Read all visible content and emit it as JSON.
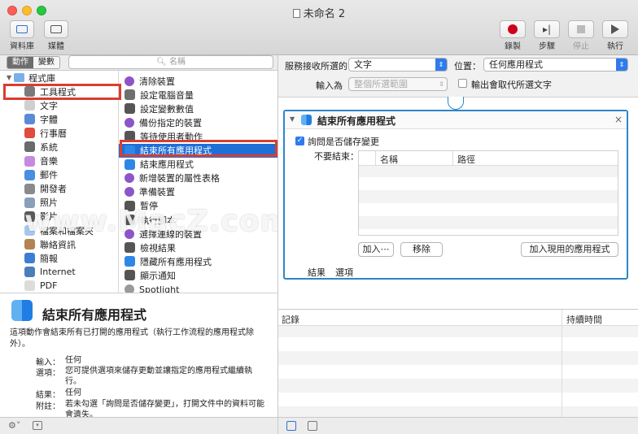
{
  "window": {
    "title": "未命名 2"
  },
  "toolbar": {
    "library_label": "資料庫",
    "media_label": "媒體",
    "record_label": "錄製",
    "step_label": "步驟",
    "stop_label": "停止",
    "run_label": "執行"
  },
  "left": {
    "actions_tab": "動作",
    "variables_tab": "變數",
    "search_placeholder": "名稱",
    "library_root": "程式庫",
    "categories": [
      {
        "label": "工具程式",
        "icon": "tools-icon",
        "color": "#7a7a7a"
      },
      {
        "label": "文字",
        "icon": "text-icon",
        "color": "#cfcfcf"
      },
      {
        "label": "字體",
        "icon": "font-icon",
        "color": "#5a8bd6"
      },
      {
        "label": "行事曆",
        "icon": "calendar-icon",
        "color": "#e04b3c"
      },
      {
        "label": "系統",
        "icon": "system-icon",
        "color": "#6a6a6a"
      },
      {
        "label": "音樂",
        "icon": "music-icon",
        "color": "#c58be0"
      },
      {
        "label": "郵件",
        "icon": "mail-icon",
        "color": "#4a8ee0"
      },
      {
        "label": "開發者",
        "icon": "developer-icon",
        "color": "#8a8a8a"
      },
      {
        "label": "照片",
        "icon": "photos-icon",
        "color": "#8aa0b8"
      },
      {
        "label": "影片",
        "icon": "movies-icon",
        "color": "#5b5b5b"
      },
      {
        "label": "檔案和檔案夾",
        "icon": "folder-icon",
        "color": "#a6c8ec"
      },
      {
        "label": "聯絡資訊",
        "icon": "contacts-icon",
        "color": "#b38451"
      },
      {
        "label": "簡報",
        "icon": "presentation-icon",
        "color": "#3d7dd4"
      },
      {
        "label": "Internet",
        "icon": "internet-icon",
        "color": "#4a7fb8"
      },
      {
        "label": "PDF",
        "icon": "pdf-icon",
        "color": "#dcdcdc"
      }
    ],
    "actions": [
      {
        "label": "清除裝置",
        "icon": "device-icon",
        "color": "#8d55c7"
      },
      {
        "label": "設定電腦音量",
        "icon": "volume-icon",
        "color": "#6e6e6e"
      },
      {
        "label": "設定變數數值",
        "icon": "robot-icon",
        "color": "#555555"
      },
      {
        "label": "備份指定的裝置",
        "icon": "device-icon",
        "color": "#8d55c7"
      },
      {
        "label": "等待使用者動作",
        "icon": "robot-icon",
        "color": "#555555"
      },
      {
        "label": "結束所有應用程式",
        "icon": "finder-icon",
        "color": "#2e86e6"
      },
      {
        "label": "結束應用程式",
        "icon": "finder-icon",
        "color": "#2e86e6"
      },
      {
        "label": "新增裝置的屬性表格",
        "icon": "device-icon",
        "color": "#8d55c7"
      },
      {
        "label": "準備裝置",
        "icon": "device-icon",
        "color": "#8d55c7"
      },
      {
        "label": "暫停",
        "icon": "robot-icon",
        "color": "#555555"
      },
      {
        "label": "執行腳本",
        "icon": "robot-icon",
        "color": "#555555"
      },
      {
        "label": "選擇連線的裝置",
        "icon": "device-icon",
        "color": "#8d55c7"
      },
      {
        "label": "檢視結果",
        "icon": "robot-icon",
        "color": "#555555"
      },
      {
        "label": "隱藏所有應用程式",
        "icon": "finder-icon",
        "color": "#2e86e6"
      },
      {
        "label": "顯示通知",
        "icon": "robot-icon",
        "color": "#555555"
      },
      {
        "label": "Spotlight",
        "icon": "spotlight-icon",
        "color": "#9a9a9a"
      }
    ],
    "selected_category": 0,
    "selected_action": 5
  },
  "description": {
    "title": "結束所有應用程式",
    "body": "這項動作會結束所有已打開的應用程式（執行工作流程的應用程式除外）。",
    "rows": [
      {
        "key": "輸入：",
        "value": "任何"
      },
      {
        "key": "選項：",
        "value": "您可提供選項來儲存更動並讓指定的應用程式繼續執行。"
      },
      {
        "key": "結果：",
        "value": "任何"
      },
      {
        "key": "附註：",
        "value": "若未勾選「詢問是否儲存變更」，打開文件中的資料可能會遺失。"
      }
    ]
  },
  "workflow": {
    "service_receives_label": "服務接收所選的",
    "service_receives_value": "文字",
    "location_label": "位置：",
    "location_value": "任何應用程式",
    "input_is_label": "輸入為",
    "input_is_value": "整個所選範圍",
    "replace_label": "輸出會取代所選文字",
    "action": {
      "title": "結束所有應用程式",
      "ask_save_label": "詢問是否儲存變更",
      "ask_save_checked": true,
      "dont_quit_label": "不要結束：",
      "col_name": "名稱",
      "col_path": "路徑",
      "add_button": "加入⋯",
      "remove_button": "移除",
      "add_current_button": "加入現用的應用程式",
      "results_tab": "結果",
      "options_tab": "選項"
    }
  },
  "log": {
    "col_log": "記錄",
    "col_duration": "持續時間"
  },
  "watermark": "www.MacZ.com",
  "colors": {
    "accent": "#1e6fd8",
    "highlight": "#d93e2e",
    "record": "#d0021b"
  }
}
